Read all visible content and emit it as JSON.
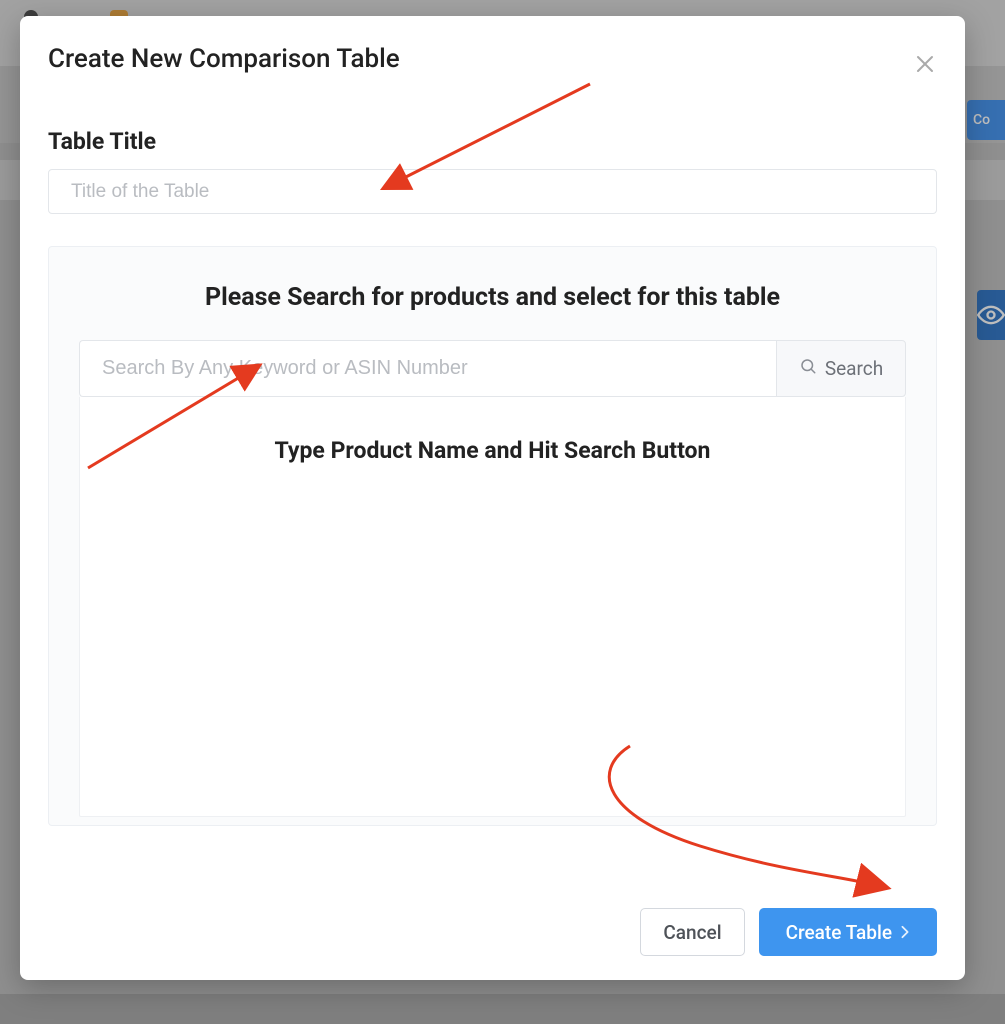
{
  "modal": {
    "title": "Create New Comparison Table",
    "title_field": {
      "label": "Table Title",
      "placeholder": "Title of the Table"
    },
    "search": {
      "heading": "Please Search for products and select for this table",
      "placeholder": "Search By Any Keyword or ASIN Number",
      "button_label": "Search",
      "results_hint": "Type Product Name and Hit Search Button"
    },
    "footer": {
      "cancel_label": "Cancel",
      "submit_label": "Create Table"
    }
  },
  "background": {
    "partial_button_text": "Co"
  }
}
